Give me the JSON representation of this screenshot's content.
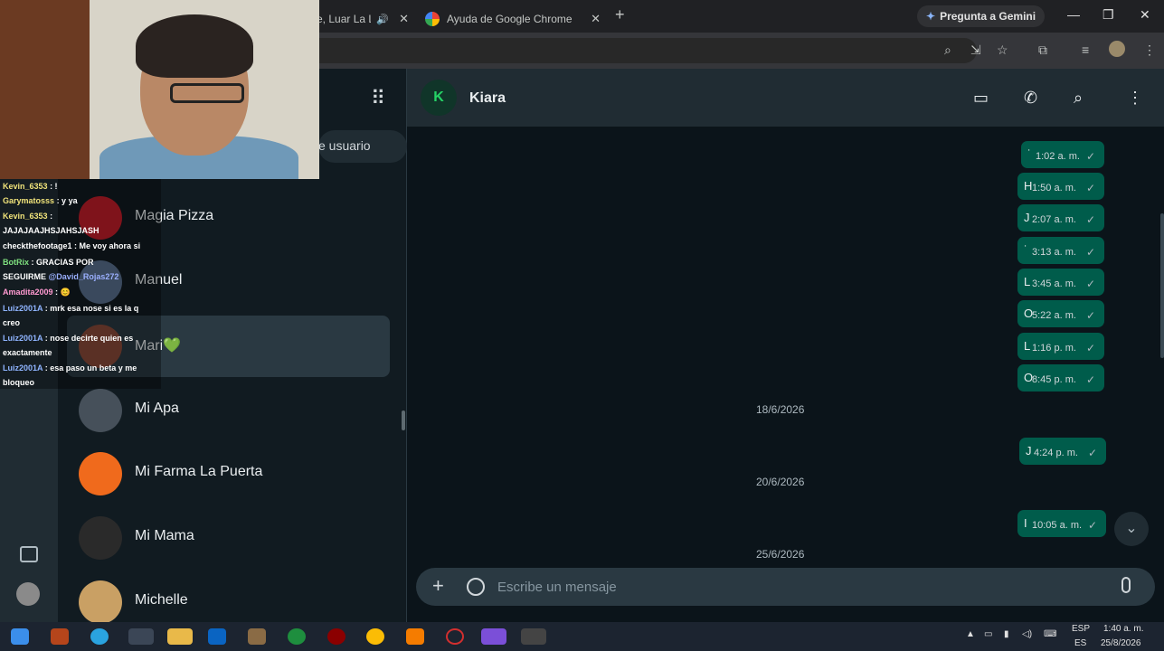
{
  "browser": {
    "tabs": [
      {
        "label": "e, Luar La L"
      },
      {
        "label": "Ayuda de Google Chrome"
      }
    ],
    "gemini_label": "Pregunta a Gemini"
  },
  "sidebar": {
    "search_hint": "e usuario",
    "chats": [
      {
        "name": "Magia Pizza",
        "avatar_color": "#c41e2a"
      },
      {
        "name": "Manuel",
        "avatar_color": "#5a7190"
      },
      {
        "name": "Mari💚",
        "avatar_color": "#8a4a3a"
      },
      {
        "name": "Mi Apa",
        "avatar_color": "#46505a"
      },
      {
        "name": "Mi Farma La Puerta",
        "avatar_color": "#f06a1c"
      },
      {
        "name": "Mi Mama",
        "avatar_color": "#2a2a2a"
      },
      {
        "name": "Michelle",
        "avatar_color": "#c9a064"
      }
    ]
  },
  "conversation": {
    "contact_initial": "K",
    "contact_name": "Kiara",
    "messages": [
      {
        "letter": "˙",
        "time": "1:02 a. m."
      },
      {
        "letter": "H",
        "time": "1:50 a. m."
      },
      {
        "letter": "J",
        "time": "2:07 a. m."
      },
      {
        "letter": "˙",
        "time": "3:13 a. m."
      },
      {
        "letter": "L",
        "time": "3:45 a. m."
      },
      {
        "letter": "O",
        "time": "5:22 a. m."
      },
      {
        "letter": "L",
        "time": "1:16 p. m."
      },
      {
        "letter": "O",
        "time": "8:45 p. m."
      },
      {
        "letter": "J",
        "time": "4:24 p. m."
      },
      {
        "letter": "I",
        "time": "10:05 a. m."
      }
    ],
    "date_chips": [
      "18/6/2026",
      "20/6/2026",
      "25/6/2026"
    ],
    "composer_placeholder": "Escribe un mensaje",
    "colors": {
      "outgoing_bubble": "#005c4b",
      "panel": "#202c33",
      "background": "#0b141a"
    }
  },
  "stream_chat": [
    {
      "user": "Kevin_6353",
      "text": ": !"
    },
    {
      "user": "Garymatosss",
      "text": ": y ya"
    },
    {
      "user": "Kevin_6353",
      "text": ":"
    },
    {
      "user": "",
      "text": "JAJAJAAJHSJAHSJASH"
    },
    {
      "user": "checkthefootage1",
      "text": ": Me voy ahora si"
    },
    {
      "user": "BotRix",
      "text": ": GRACIAS POR"
    },
    {
      "user": "",
      "text": "SEGUIRME",
      "mention": "@David_Rojas272"
    },
    {
      "user": "Amadita2009",
      "text": ": 😊"
    },
    {
      "user": "Luiz2001A",
      "text": ": mrk esa nose si es la q"
    },
    {
      "user": "",
      "text": "creo"
    },
    {
      "user": "Luiz2001A",
      "text": ": nose decirte quien es"
    },
    {
      "user": "",
      "text": "exactamente"
    },
    {
      "user": "Luiz2001A",
      "text": ": esa paso un beta y me"
    },
    {
      "user": "",
      "text": "bloqueo"
    }
  ],
  "taskbar": {
    "lang": "ESP",
    "lang_sub": "ES",
    "time": "1:40 a. m.",
    "date": "25/8/2026"
  }
}
